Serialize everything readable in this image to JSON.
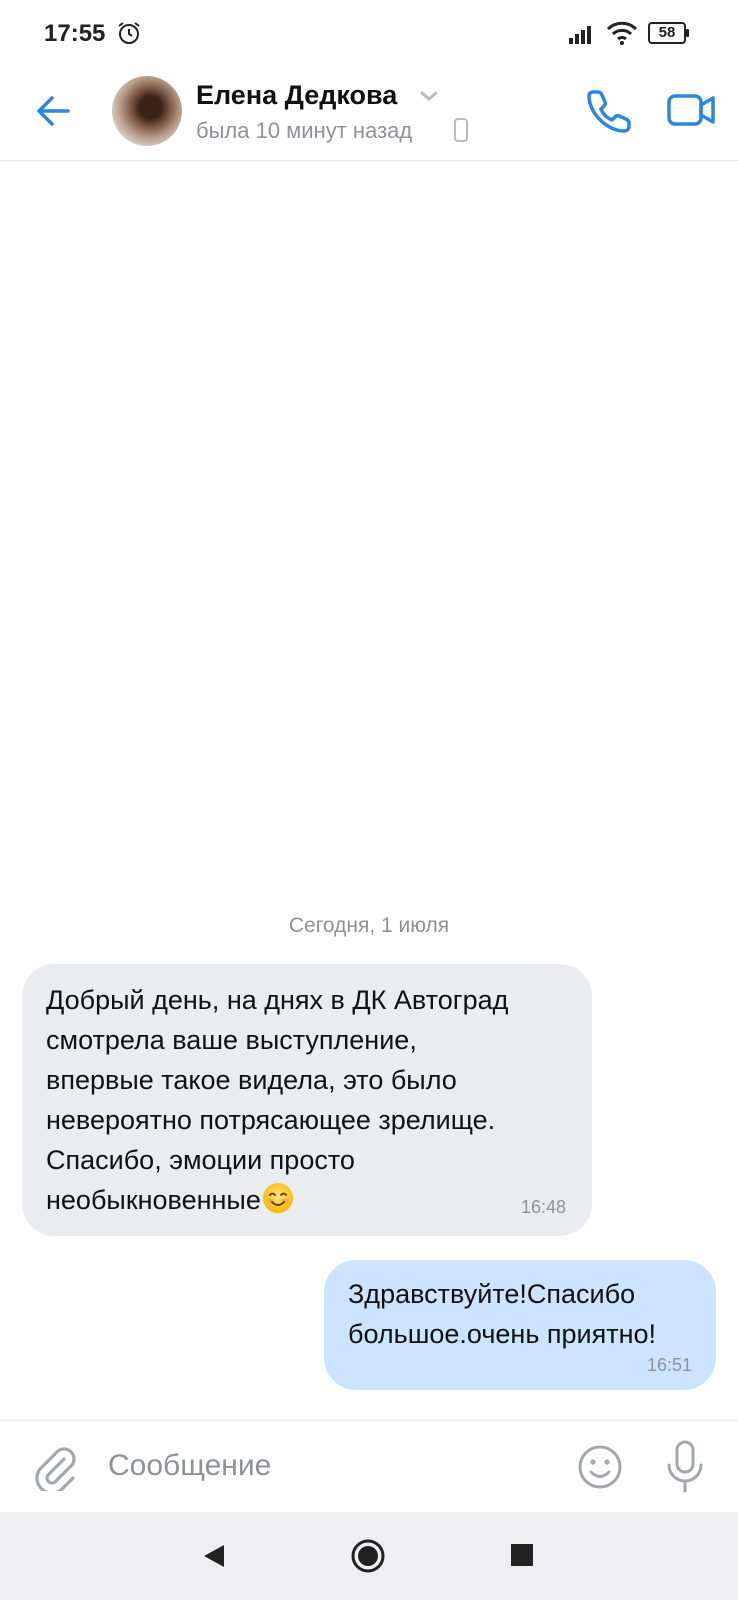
{
  "status_bar": {
    "time": "17:55",
    "battery": "58",
    "icons": [
      "alarm-icon",
      "signal-icon",
      "wifi-icon",
      "battery-icon"
    ]
  },
  "header": {
    "contact_name": "Елена Дедкова",
    "contact_status": "была 10 минут назад",
    "icons": [
      "back-arrow-icon",
      "chevron-down-icon",
      "mobile-phone-icon",
      "phone-call-icon",
      "video-call-icon"
    ]
  },
  "chat": {
    "date_separator": "Сегодня, 1 июля",
    "messages": [
      {
        "direction": "incoming",
        "lines": [
          "Добрый день, на днях в ДК Автоград",
          "смотрела ваше выступление,",
          "впервые такое видела, это было",
          "невероятно потрясающее зрелище.",
          "Спасибо, эмоции просто",
          "необыкновенные"
        ],
        "emoji": "smiling-face-icon",
        "time": "16:48"
      },
      {
        "direction": "outgoing",
        "lines": [
          "Здравствуйте!Спасибо",
          "большое.очень приятно!"
        ],
        "time": "16:51"
      }
    ]
  },
  "composer": {
    "placeholder": "Сообщение",
    "value": "",
    "icons": [
      "paperclip-icon",
      "emoji-icon",
      "microphone-icon"
    ]
  },
  "nav_bar": {
    "icons": [
      "nav-back-icon",
      "nav-home-icon",
      "nav-recent-icon"
    ]
  },
  "colors": {
    "accent": "#2a86e0",
    "incoming_bubble": "#ebecf0",
    "outgoing_bubble": "#cce4ff",
    "secondary_text": "#8e9199",
    "nav_background": "#efeff1"
  }
}
